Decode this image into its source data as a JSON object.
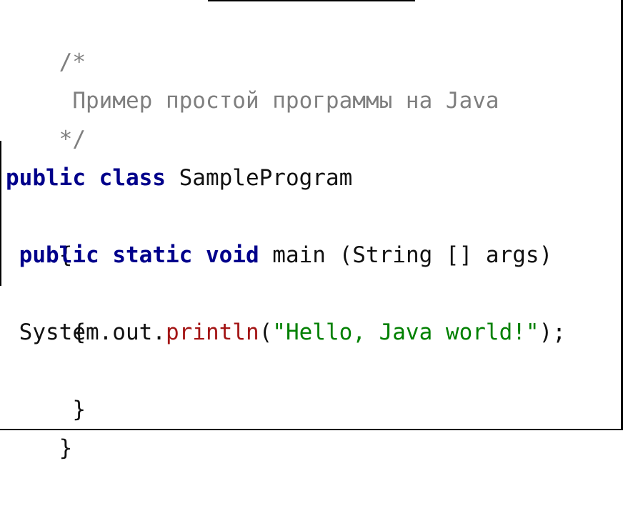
{
  "code": {
    "comment_open": "/*",
    "comment_text": " Пример простой программы на Java",
    "comment_close": "*/",
    "blank": "",
    "line_public": "public",
    "line_class": "class",
    "class_name": " SampleProgram",
    "brace_open_outer": "{",
    "indent_1": " ",
    "kw_public": "public",
    "kw_static": "static",
    "kw_void": "void",
    "main_signature": " main (String [] args)",
    "brace_open_inner": " {",
    "system_out": " System.out.",
    "println": "println",
    "paren_open": "(",
    "hello_string": "\"Hello, Java world!\"",
    "paren_close": ");",
    "brace_close_inner": " }",
    "brace_close_outer": "}"
  }
}
